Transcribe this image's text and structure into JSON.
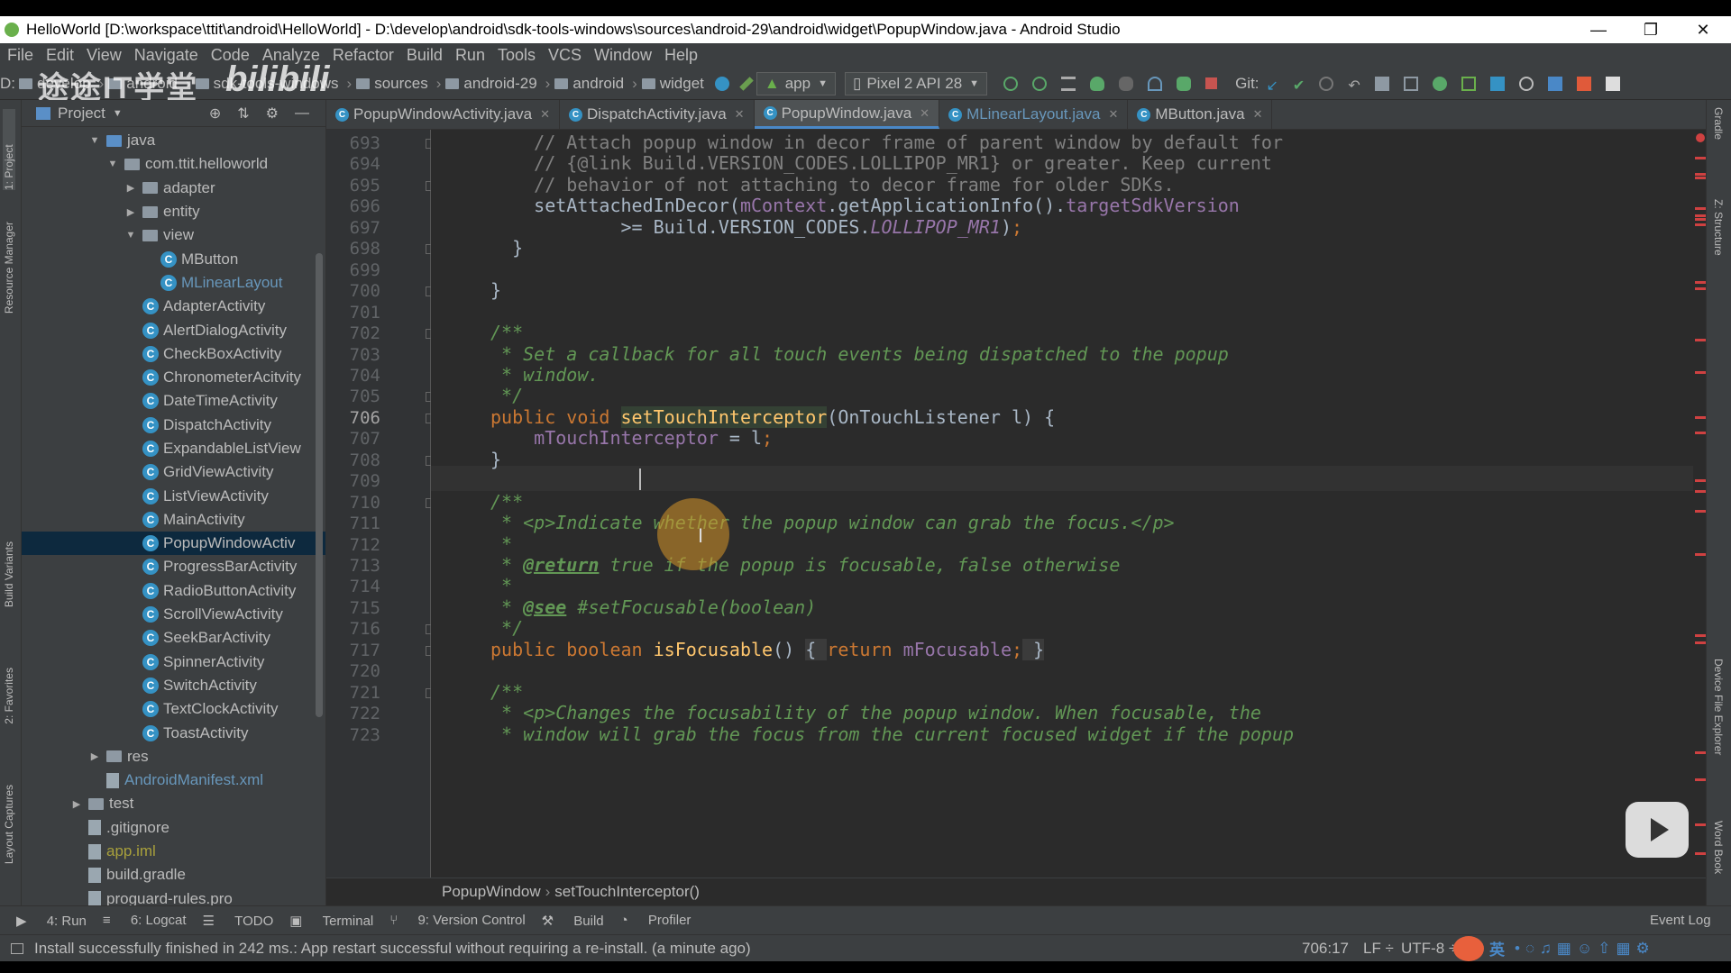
{
  "window": {
    "title": "HelloWorld [D:\\workspace\\ttit\\android\\HelloWorld] - D:\\develop\\android\\sdk-tools-windows\\sources\\android-29\\android\\widget\\PopupWindow.java - Android Studio",
    "minimize": "—",
    "maximize": "❐",
    "close": "✕"
  },
  "menu": [
    "File",
    "Edit",
    "View",
    "Navigate",
    "Code",
    "Analyze",
    "Refactor",
    "Build",
    "Run",
    "Tools",
    "VCS",
    "Window",
    "Help"
  ],
  "navbar": {
    "drive": "D:",
    "crumbs": [
      "develop",
      "android",
      "sdk-tools-windows",
      "sources",
      "android-29",
      "android",
      "widget"
    ],
    "run_config": "app",
    "device": "Pixel 2 API 28",
    "git_label": "Git:"
  },
  "watermark": {
    "text": "途途IT学堂",
    "logo": "bilibili"
  },
  "left_strip": [
    "1: Project",
    "Resource Manager",
    "Build Variants",
    "2: Favorites",
    "Layout Captures"
  ],
  "right_strip": [
    "Gradle",
    "Z: Structure",
    "Device File Explorer",
    "Word Book"
  ],
  "project": {
    "title": "Project",
    "tree": [
      {
        "label": "java",
        "indent": 1,
        "icon": "folder-src",
        "arrow": "▼"
      },
      {
        "label": "com.ttit.helloworld",
        "indent": 2,
        "icon": "folder",
        "arrow": "▼"
      },
      {
        "label": "adapter",
        "indent": 3,
        "icon": "folder",
        "arrow": "▶"
      },
      {
        "label": "entity",
        "indent": 3,
        "icon": "folder",
        "arrow": "▶"
      },
      {
        "label": "view",
        "indent": 3,
        "icon": "folder",
        "arrow": "▼"
      },
      {
        "label": "MButton",
        "indent": 4,
        "icon": "class"
      },
      {
        "label": "MLinearLayout",
        "indent": 4,
        "icon": "class",
        "modified": true
      },
      {
        "label": "AdapterActivity",
        "indent": 3,
        "icon": "class"
      },
      {
        "label": "AlertDialogActivity",
        "indent": 3,
        "icon": "class"
      },
      {
        "label": "CheckBoxActivity",
        "indent": 3,
        "icon": "class"
      },
      {
        "label": "ChronometerAcitvity",
        "indent": 3,
        "icon": "class"
      },
      {
        "label": "DateTimeActivity",
        "indent": 3,
        "icon": "class"
      },
      {
        "label": "DispatchActivity",
        "indent": 3,
        "icon": "class"
      },
      {
        "label": "ExpandableListView",
        "indent": 3,
        "icon": "class"
      },
      {
        "label": "GridViewActivity",
        "indent": 3,
        "icon": "class"
      },
      {
        "label": "ListViewActivity",
        "indent": 3,
        "icon": "class"
      },
      {
        "label": "MainActivity",
        "indent": 3,
        "icon": "class"
      },
      {
        "label": "PopupWindowActiv",
        "indent": 3,
        "icon": "class",
        "selected": true
      },
      {
        "label": "ProgressBarActivity",
        "indent": 3,
        "icon": "class"
      },
      {
        "label": "RadioButtonActivity",
        "indent": 3,
        "icon": "class"
      },
      {
        "label": "ScrollViewActivity",
        "indent": 3,
        "icon": "class"
      },
      {
        "label": "SeekBarActivity",
        "indent": 3,
        "icon": "class"
      },
      {
        "label": "SpinnerActivity",
        "indent": 3,
        "icon": "class"
      },
      {
        "label": "SwitchActivity",
        "indent": 3,
        "icon": "class"
      },
      {
        "label": "TextClockActivity",
        "indent": 3,
        "icon": "class"
      },
      {
        "label": "ToastActivity",
        "indent": 3,
        "icon": "class"
      },
      {
        "label": "res",
        "indent": 1,
        "icon": "folder",
        "arrow": "▶"
      },
      {
        "label": "AndroidManifest.xml",
        "indent": 1,
        "icon": "file",
        "modified": true
      },
      {
        "label": "test",
        "indent": 0,
        "icon": "folder",
        "arrow": "▶"
      },
      {
        "label": ".gitignore",
        "indent": 0,
        "icon": "file"
      },
      {
        "label": "app.iml",
        "indent": 0,
        "icon": "file",
        "ignored": true
      },
      {
        "label": "build.gradle",
        "indent": 0,
        "icon": "file"
      },
      {
        "label": "proguard-rules.pro",
        "indent": 0,
        "icon": "file"
      }
    ]
  },
  "tabs": [
    {
      "label": "PopupWindowActivity.java",
      "active": false
    },
    {
      "label": "DispatchActivity.java",
      "active": false
    },
    {
      "label": "PopupWindow.java",
      "active": true
    },
    {
      "label": "MLinearLayout.java",
      "active": false,
      "modified": true
    },
    {
      "label": "MButton.java",
      "active": false
    }
  ],
  "editor": {
    "current_line": "706",
    "lines": [
      {
        "n": "693",
        "html": "<span class='cmt'>    // Attach popup window in decor frame of parent window by default for</span>"
      },
      {
        "n": "694",
        "html": "<span class='cmt'>    // {@link Build.VERSION_CODES.LOLLIPOP_MR1} or greater. Keep current</span>"
      },
      {
        "n": "695",
        "html": "<span class='cmt'>    // behavior of not attaching to decor frame for older SDKs.</span>"
      },
      {
        "n": "696",
        "html": "    setAttachedInDecor(<span class='fld2'>mContext</span>.getApplicationInfo().<span class='fld2'>targetSdkVersion</span>"
      },
      {
        "n": "697",
        "html": "            >= Build.VERSION_CODES.<span class='cst'>LOLLIPOP_MR1</span>)<span class='kw'>;</span>"
      },
      {
        "n": "698",
        "html": "  }"
      },
      {
        "n": "699",
        "html": ""
      },
      {
        "n": "700",
        "html": "}"
      },
      {
        "n": "701",
        "html": ""
      },
      {
        "n": "702",
        "html": "<span class='doc'>/**</span>"
      },
      {
        "n": "703",
        "html": "<span class='doc'> * Set a callback for all touch events being dispatched to the popup</span>"
      },
      {
        "n": "704",
        "html": "<span class='doc'> * window.</span>"
      },
      {
        "n": "705",
        "html": "<span class='doc'> */</span>"
      },
      {
        "n": "706",
        "html": "<span class='kw'>public void </span><span class='fn hlbox'>setTouchInterceptor</span>(OnTouchListener l) {"
      },
      {
        "n": "707",
        "html": "    <span class='fld2'>mTouchInterceptor</span> = l<span class='kw'>;</span>"
      },
      {
        "n": "708",
        "html": "}"
      },
      {
        "n": "709",
        "html": ""
      },
      {
        "n": "710",
        "html": "<span class='doc'>/**</span>"
      },
      {
        "n": "711",
        "html": "<span class='doc'> * &lt;p&gt;Indicate whether the popup window can grab the focus.&lt;/p&gt;</span>"
      },
      {
        "n": "712",
        "html": "<span class='doc'> *</span>"
      },
      {
        "n": "713",
        "html": "<span class='doc'> * </span><span class='doctag'>@return</span><span class='doc'> true if the popup is focusable, false otherwise</span>"
      },
      {
        "n": "714",
        "html": "<span class='doc'> *</span>"
      },
      {
        "n": "715",
        "html": "<span class='doc'> * </span><span class='doctag'>@see</span><span class='doc'> #setFocusable(boolean)</span>"
      },
      {
        "n": "716",
        "html": "<span class='doc'> */</span>"
      },
      {
        "n": "717",
        "html": "<span class='kw'>public boolean </span><span class='fn'>isFocusable</span>() <span style='background:#3b3b3b'>{ </span><span class='kw'>return </span><span class='fld2'>mFocusable</span><span class='kw'>;</span><span style='background:#3b3b3b'> }</span>"
      },
      {
        "n": "720",
        "html": ""
      },
      {
        "n": "721",
        "html": "<span class='doc'>/**</span>"
      },
      {
        "n": "722",
        "html": "<span class='doc'> * &lt;p&gt;Changes the focusability of the popup window. When focusable, the</span>"
      },
      {
        "n": "723",
        "html": "<span class='doc'> * window will grab the focus from the current focused widget if the popup</span>"
      }
    ]
  },
  "code_breadcrumb": {
    "class": "PopupWindow",
    "method": "setTouchInterceptor()"
  },
  "tool_windows": [
    "4: Run",
    "6: Logcat",
    "TODO",
    "Terminal",
    "9: Version Control",
    "Build",
    "Profiler"
  ],
  "event_log": "Event Log",
  "status": {
    "message": "Install successfully finished in 242 ms.: App restart successful without requiring a re-install. (a minute ago)",
    "position": "706:17",
    "line_sep": "LF ÷",
    "encoding": "UTF-8 ÷"
  },
  "ime": {
    "lang": "英"
  },
  "colors": {
    "accent": "#4a88c7",
    "error": "#cf4141",
    "keyword": "#cc7832",
    "doc": "#629755"
  }
}
